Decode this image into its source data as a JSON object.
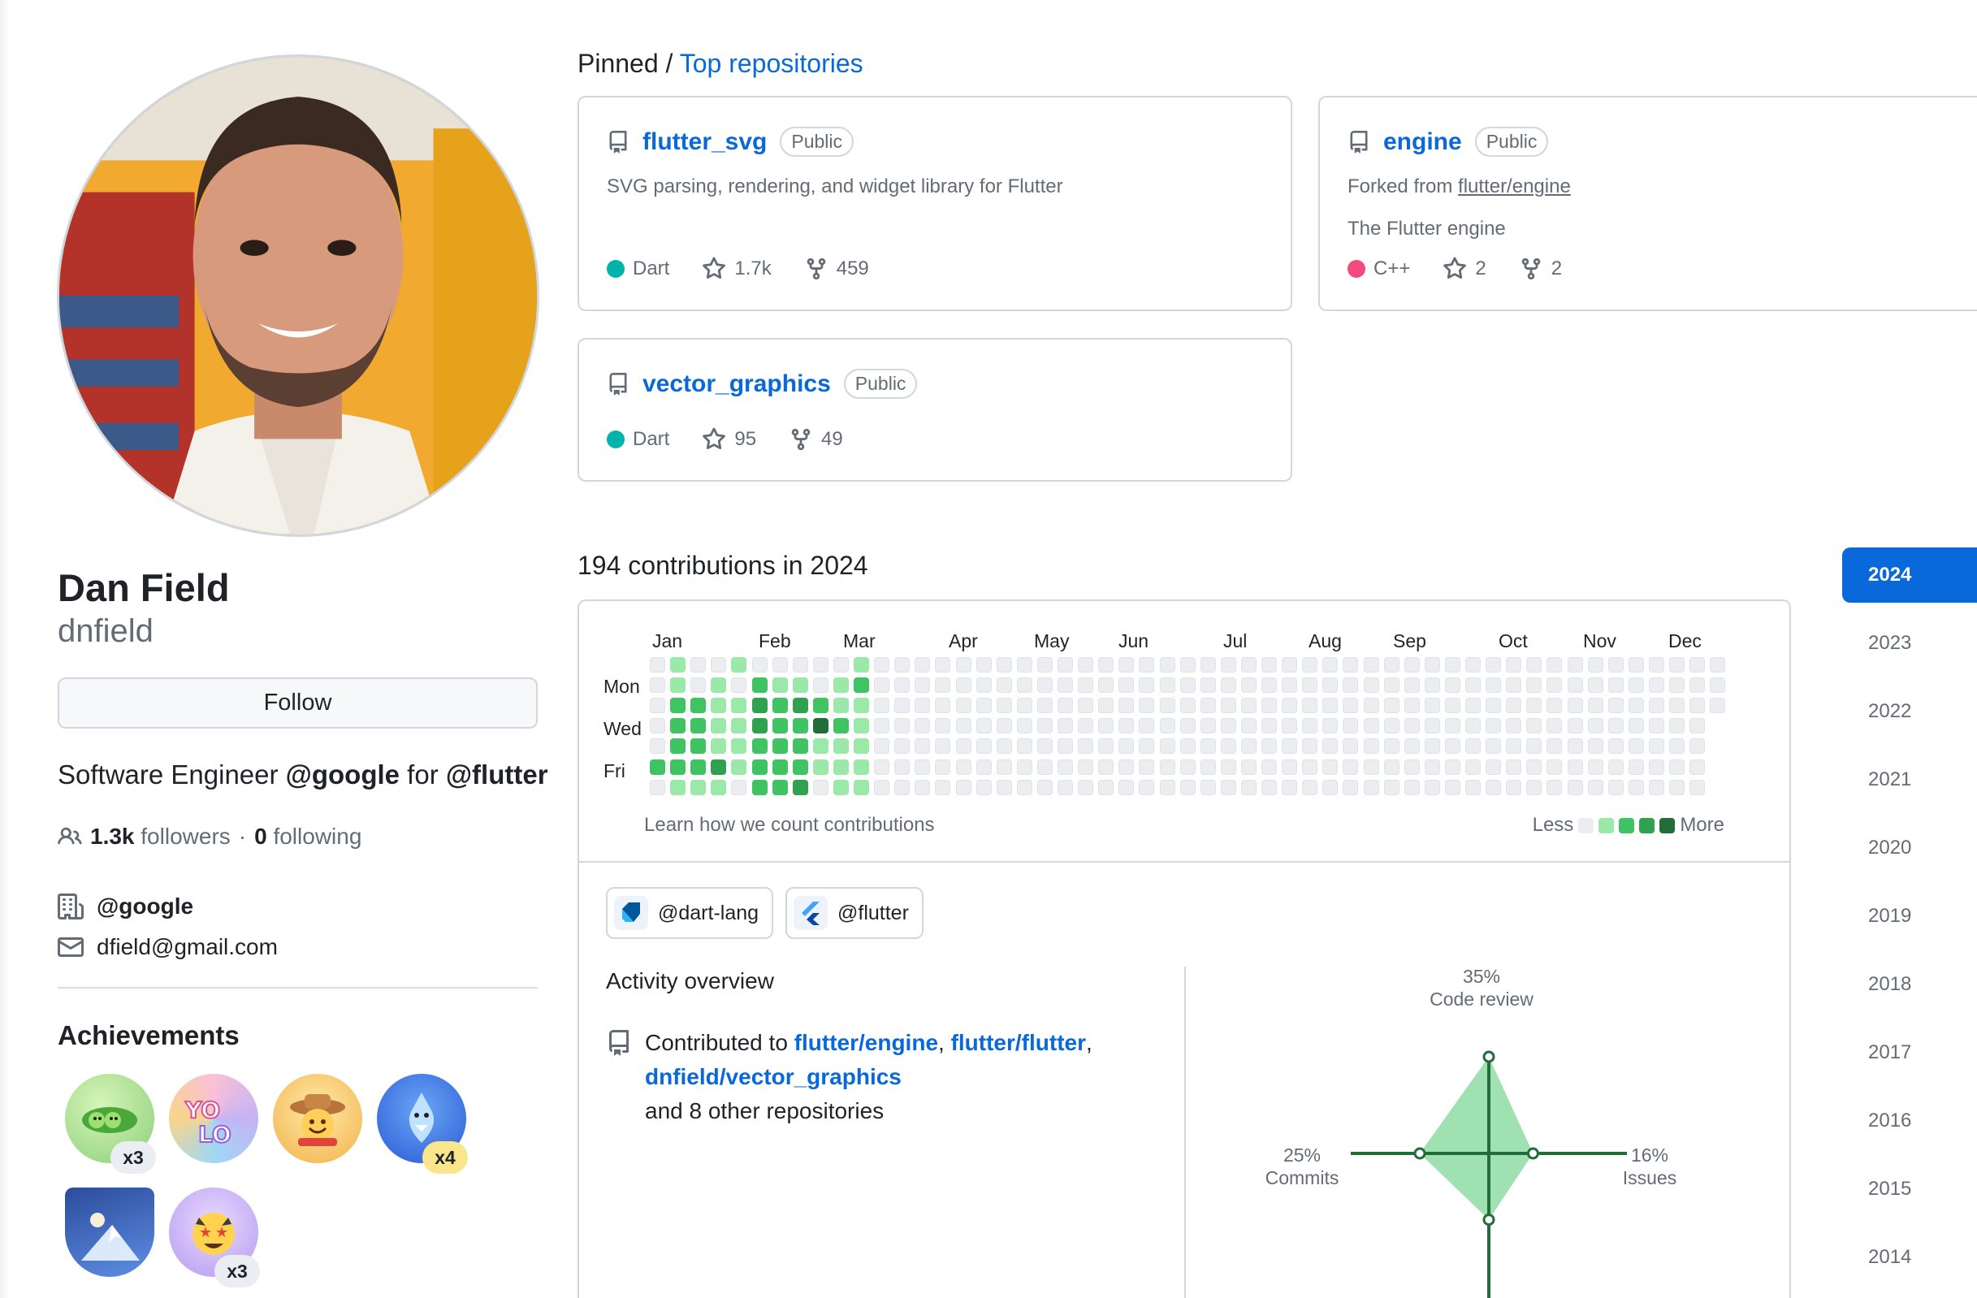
{
  "profile": {
    "name": "Dan Field",
    "username": "dnfield",
    "follow_label": "Follow",
    "bio_prefix": "Software Engineer ",
    "bio_org1": "@google",
    "bio_mid": " for ",
    "bio_org2": "@flutter",
    "followers_count": "1.3k",
    "followers_label": "followers",
    "following_sep": "·",
    "following_count": "0",
    "following_label": "following",
    "company": "@google",
    "email": "dfield@gmail.com"
  },
  "achievements": {
    "title": "Achievements",
    "badges": [
      {
        "name": "pair-extraordinaire",
        "count": "x3"
      },
      {
        "name": "yolo",
        "count": ""
      },
      {
        "name": "pull-shark-cowboy",
        "count": ""
      },
      {
        "name": "pull-shark",
        "count": "x4"
      },
      {
        "name": "arctic-code-vault",
        "count": ""
      },
      {
        "name": "starstruck",
        "count": "x3"
      }
    ]
  },
  "pinned": {
    "title_prefix": "Pinned / ",
    "title_link": "Top repositories",
    "repos": [
      {
        "name": "flutter_svg",
        "visibility": "Public",
        "description": "SVG parsing, rendering, and widget library for Flutter",
        "language": "Dart",
        "language_color": "#00B4AB",
        "stars": "1.7k",
        "forks": "459"
      },
      {
        "name": "engine",
        "visibility": "Public",
        "forked_prefix": "Forked from ",
        "forked_from": "flutter/engine",
        "description": "The Flutter engine",
        "language": "C++",
        "language_color": "#f34b7d",
        "stars": "2",
        "forks": "2"
      },
      {
        "name": "vector_graphics",
        "visibility": "Public",
        "language": "Dart",
        "language_color": "#00B4AB",
        "stars": "95",
        "forks": "49"
      }
    ]
  },
  "contributions": {
    "title": "194 contributions in 2024",
    "months": [
      "Jan",
      "Feb",
      "Mar",
      "Apr",
      "May",
      "Jun",
      "Jul",
      "Aug",
      "Sep",
      "Oct",
      "Nov",
      "Dec"
    ],
    "days": [
      "Mon",
      "Wed",
      "Fri"
    ],
    "learn_link": "Learn how we count contributions",
    "legend_less": "Less",
    "legend_more": "More",
    "level_colors": [
      "#ebedf0",
      "#9be9a8",
      "#40c463",
      "#30a14e",
      "#216e39"
    ],
    "levels": [
      [
        0,
        0,
        0,
        0,
        0,
        2,
        0
      ],
      [
        1,
        1,
        2,
        2,
        2,
        2,
        1
      ],
      [
        0,
        0,
        2,
        2,
        2,
        2,
        1
      ],
      [
        0,
        1,
        1,
        1,
        1,
        3,
        1
      ],
      [
        1,
        0,
        1,
        1,
        1,
        1,
        0
      ],
      [
        0,
        2,
        3,
        3,
        2,
        2,
        2
      ],
      [
        0,
        1,
        2,
        2,
        2,
        2,
        2
      ],
      [
        0,
        1,
        3,
        2,
        2,
        2,
        3
      ],
      [
        0,
        0,
        2,
        4,
        1,
        1,
        0
      ],
      [
        0,
        1,
        1,
        2,
        1,
        1,
        1
      ],
      [
        1,
        2,
        1,
        1,
        1,
        1,
        1
      ]
    ],
    "orgs": [
      "@dart-lang",
      "@flutter"
    ],
    "activity_title": "Activity overview",
    "activity_prefix": "Contributed to ",
    "activity_repo1": "flutter/engine",
    "activity_sep1": ", ",
    "activity_repo2": "flutter/flutter",
    "activity_sep2": ",",
    "activity_repo3": "dnfield/vector_graphics",
    "activity_suffix": "and 8 other repositories",
    "radar": {
      "code_review_pct": "35%",
      "code_review_label": "Code review",
      "commits_pct": "25%",
      "commits_label": "Commits",
      "issues_pct": "16%",
      "issues_label": "Issues",
      "values": {
        "code_review": 35,
        "commits": 25,
        "issues": 16,
        "pull_requests": 24
      }
    }
  },
  "years": [
    "2024",
    "2023",
    "2022",
    "2021",
    "2020",
    "2019",
    "2018",
    "2017",
    "2016",
    "2015",
    "2014"
  ],
  "selected_year": "2024"
}
